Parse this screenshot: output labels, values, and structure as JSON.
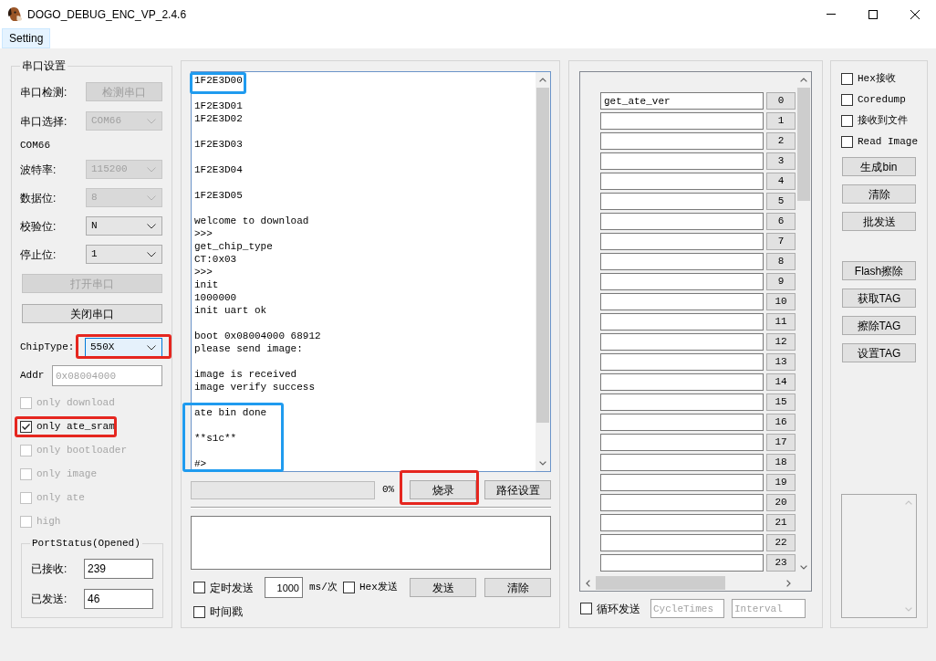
{
  "window": {
    "title": "DOGO_DEBUG_ENC_VP_2.4.6"
  },
  "menu": [
    {
      "label": "Setting",
      "selected": true
    }
  ],
  "serial_settings": {
    "title": "串口设置",
    "rows": [
      {
        "kind": "button",
        "label": "串口检测:",
        "value": "检测串口",
        "disabled": true
      },
      {
        "kind": "select",
        "label": "串口选择:",
        "value": "COM66",
        "disabled": true
      },
      {
        "kind": "note",
        "value": "COM66"
      },
      {
        "kind": "select",
        "label": "波特率:",
        "value": "115200",
        "disabled": true
      },
      {
        "kind": "select",
        "label": "数据位:",
        "value": "8",
        "disabled": true
      },
      {
        "kind": "select",
        "label": "校验位:",
        "value": "N",
        "disabled": false
      },
      {
        "kind": "select",
        "label": "停止位:",
        "value": "1",
        "disabled": false
      }
    ],
    "actions": [
      {
        "label": "打开串口",
        "disabled": true
      },
      {
        "label": "关闭串口",
        "disabled": false
      }
    ],
    "chip_type": {
      "label": "ChipType:",
      "value": "550X",
      "focused": true,
      "highlight": {
        "color": "#e5261f"
      }
    },
    "addr": {
      "label": "Addr",
      "placeholder": "0x08004000"
    },
    "options": [
      {
        "label": "only download",
        "checked": false,
        "disabled": true
      },
      {
        "label": "only ate_sram",
        "checked": true,
        "disabled": false,
        "highlight": {
          "color": "#e5261f"
        }
      },
      {
        "label": "only bootloader",
        "checked": false,
        "disabled": true
      },
      {
        "label": "only image",
        "checked": false,
        "disabled": true
      },
      {
        "label": "only ate",
        "checked": false,
        "disabled": true
      },
      {
        "label": "high",
        "checked": false,
        "disabled": true
      }
    ],
    "port_status": {
      "title": "PortStatus(Opened)",
      "fields": [
        {
          "label": "已接收:",
          "value": "239"
        },
        {
          "label": "已发送:",
          "value": "46"
        }
      ]
    }
  },
  "log": {
    "sections": [
      {
        "highlight": {
          "color": "#1f9bef"
        },
        "paragraphs": [
          [
            "1F2E3D00"
          ]
        ]
      },
      {
        "paragraphs": [
          [
            "1F2E3D01",
            "1F2E3D02"
          ],
          [
            "1F2E3D03"
          ],
          [
            "1F2E3D04"
          ],
          [
            "1F2E3D05"
          ],
          [
            "welcome to download",
            ">>>",
            "get_chip_type",
            "CT:0x03",
            ">>>",
            "init",
            "1000000",
            "init uart ok"
          ],
          [
            "boot 0x08004000 68912",
            "please send image:"
          ],
          [
            "image is received",
            "image verify success"
          ]
        ]
      },
      {
        "highlight": {
          "color": "#1f9bef"
        },
        "paragraphs": [
          [
            "ate bin done"
          ],
          [
            "**s1c**"
          ],
          [
            "#>"
          ]
        ]
      }
    ]
  },
  "burn": {
    "progress": {
      "reading": "0%"
    },
    "burn_button": {
      "label": "烧录",
      "highlight": {
        "color": "#e5261f"
      }
    },
    "path_button": {
      "label": "路径设置"
    }
  },
  "send": {
    "timed_send": {
      "label": "定时发送",
      "checked": false
    },
    "interval": {
      "value": "1000",
      "unit": "ms/次"
    },
    "hex_send": {
      "label": "Hex发送",
      "checked": false
    },
    "buttons": [
      {
        "label": "发送"
      },
      {
        "label": "清除"
      }
    ],
    "timestamp": {
      "label": "时间戳",
      "checked": false
    }
  },
  "commands": {
    "rows": [
      {
        "value": "get_ate_ver",
        "button": "0"
      },
      {
        "button": "1"
      },
      {
        "button": "2"
      },
      {
        "button": "3"
      },
      {
        "button": "4"
      },
      {
        "button": "5"
      },
      {
        "button": "6"
      },
      {
        "button": "7"
      },
      {
        "button": "8"
      },
      {
        "button": "9"
      },
      {
        "button": "10"
      },
      {
        "button": "11"
      },
      {
        "button": "12"
      },
      {
        "button": "13"
      },
      {
        "button": "14"
      },
      {
        "button": "15"
      },
      {
        "button": "16"
      },
      {
        "button": "17"
      },
      {
        "button": "18"
      },
      {
        "button": "19"
      },
      {
        "button": "20"
      },
      {
        "button": "21"
      },
      {
        "button": "22"
      },
      {
        "button": "23"
      }
    ],
    "loop_send": {
      "label": "循环发送",
      "checked": false
    },
    "cycle_times": {
      "placeholder": "CycleTimes"
    },
    "interval": {
      "placeholder": "Interval"
    }
  },
  "tools": {
    "options": [
      {
        "label": "Hex接收",
        "checked": false
      },
      {
        "label": "Coredump",
        "checked": false
      },
      {
        "label": "接收到文件",
        "checked": false
      },
      {
        "label": "Read Image",
        "checked": false
      }
    ],
    "button_groups": [
      [
        {
          "label": "生成bin"
        },
        {
          "label": "清除"
        },
        {
          "label": "批发送"
        }
      ],
      [
        {
          "label": "Flash擦除"
        },
        {
          "label": "获取TAG"
        },
        {
          "label": "擦除TAG"
        },
        {
          "label": "设置TAG"
        }
      ]
    ]
  }
}
